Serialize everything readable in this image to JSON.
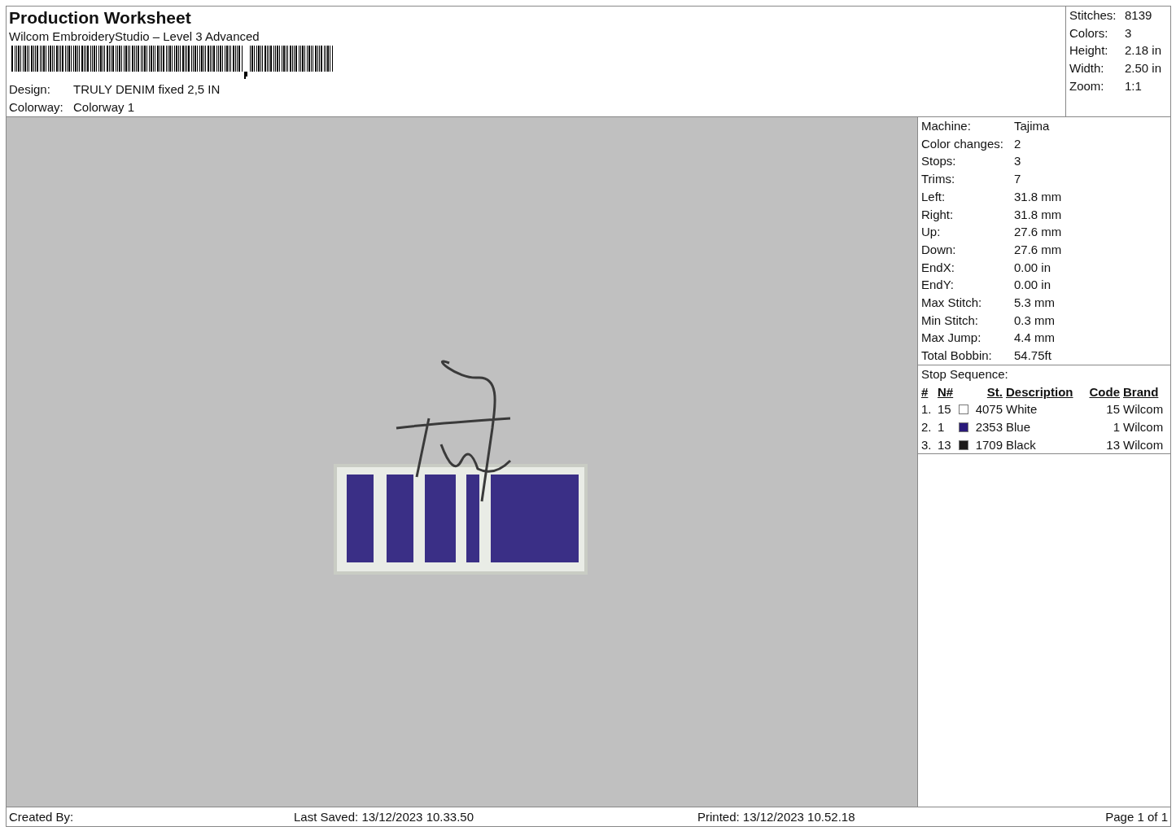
{
  "header": {
    "title": "Production Worksheet",
    "subtitle": "Wilcom EmbroideryStudio – Level 3 Advanced",
    "fields": [
      {
        "label": "Design:",
        "value": "TRULY DENIM fixed 2,5 IN"
      },
      {
        "label": "Colorway:",
        "value": "Colorway 1"
      }
    ]
  },
  "summary": [
    {
      "label": "Stitches:",
      "value": "8139"
    },
    {
      "label": "Colors:",
      "value": "3"
    },
    {
      "label": "Height:",
      "value": "2.18 in"
    },
    {
      "label": "Width:",
      "value": "2.50 in"
    },
    {
      "label": "Zoom:",
      "value": "1:1"
    }
  ],
  "machine_info": [
    {
      "label": "Machine:",
      "value": "Tajima"
    },
    {
      "label": "Color changes:",
      "value": "2"
    },
    {
      "label": "Stops:",
      "value": "3"
    },
    {
      "label": "Trims:",
      "value": "7"
    },
    {
      "label": "Left:",
      "value": "31.8 mm"
    },
    {
      "label": "Right:",
      "value": "31.8 mm"
    },
    {
      "label": "Up:",
      "value": "27.6 mm"
    },
    {
      "label": "Down:",
      "value": "27.6 mm"
    },
    {
      "label": "EndX:",
      "value": "0.00 in"
    },
    {
      "label": "EndY:",
      "value": "0.00 in"
    },
    {
      "label": "Max Stitch:",
      "value": "5.3 mm"
    },
    {
      "label": "Min Stitch:",
      "value": "0.3 mm"
    },
    {
      "label": "Max Jump:",
      "value": "4.4 mm"
    },
    {
      "label": "Total Bobbin:",
      "value": "54.75ft"
    }
  ],
  "stop_sequence": {
    "title": "Stop Sequence:",
    "columns": [
      "#",
      "N#",
      "St.",
      "Description",
      "Code",
      "Brand"
    ],
    "rows": [
      {
        "index": "1.",
        "needle": "15",
        "color": "#ffffff",
        "stitch": "4075",
        "description": "White",
        "code": "15",
        "brand": "Wilcom"
      },
      {
        "index": "2.",
        "needle": "1",
        "color": "#2a1a7a",
        "stitch": "2353",
        "description": "Blue",
        "code": "1",
        "brand": "Wilcom"
      },
      {
        "index": "3.",
        "needle": "13",
        "color": "#1c1a1a",
        "stitch": "1709",
        "description": "Black",
        "code": "13",
        "brand": "Wilcom"
      }
    ]
  },
  "footer": {
    "created_by": "Created By:",
    "last_saved": "Last Saved: 13/12/2023 10.33.50",
    "printed": "Printed: 13/12/2023 10.52.18",
    "page": "Page 1 of 1"
  }
}
